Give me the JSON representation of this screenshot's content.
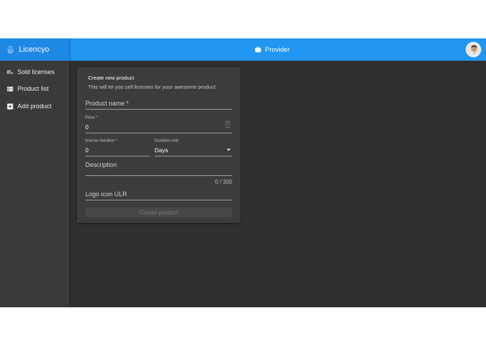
{
  "brand": {
    "name": "Licencyo"
  },
  "header": {
    "title": "Provider"
  },
  "sidebar": {
    "items": [
      {
        "label": "Sold licenses"
      },
      {
        "label": "Product list"
      },
      {
        "label": "Add product"
      }
    ]
  },
  "form": {
    "title": "Create new product",
    "subtitle": "This will let you sell licenses for your awesome product",
    "product_name_label": "Product name *",
    "price_label": "Price *",
    "price_value": "0",
    "license_duration_label": "license duration *",
    "license_duration_value": "0",
    "duration_unit_label": "Duration unit",
    "duration_unit_value": "Days",
    "description_label": "Description",
    "description_counter": "0 / 300",
    "logo_label": "Logo icon ULR",
    "submit_label": "Create product"
  },
  "colors": {
    "topbar": "#2196f3",
    "sidebar": "#3a3a3a",
    "content": "#2f2f2f",
    "card": "#3c3c3c"
  },
  "icons": {
    "brand": "fingerprint-icon",
    "header": "store-icon",
    "sold_licenses": "playlist-check-icon",
    "product_list": "view-list-icon",
    "add_product": "plus-box-icon",
    "price": "fingerprint-icon",
    "duration_unit": "chevron-down-icon"
  }
}
